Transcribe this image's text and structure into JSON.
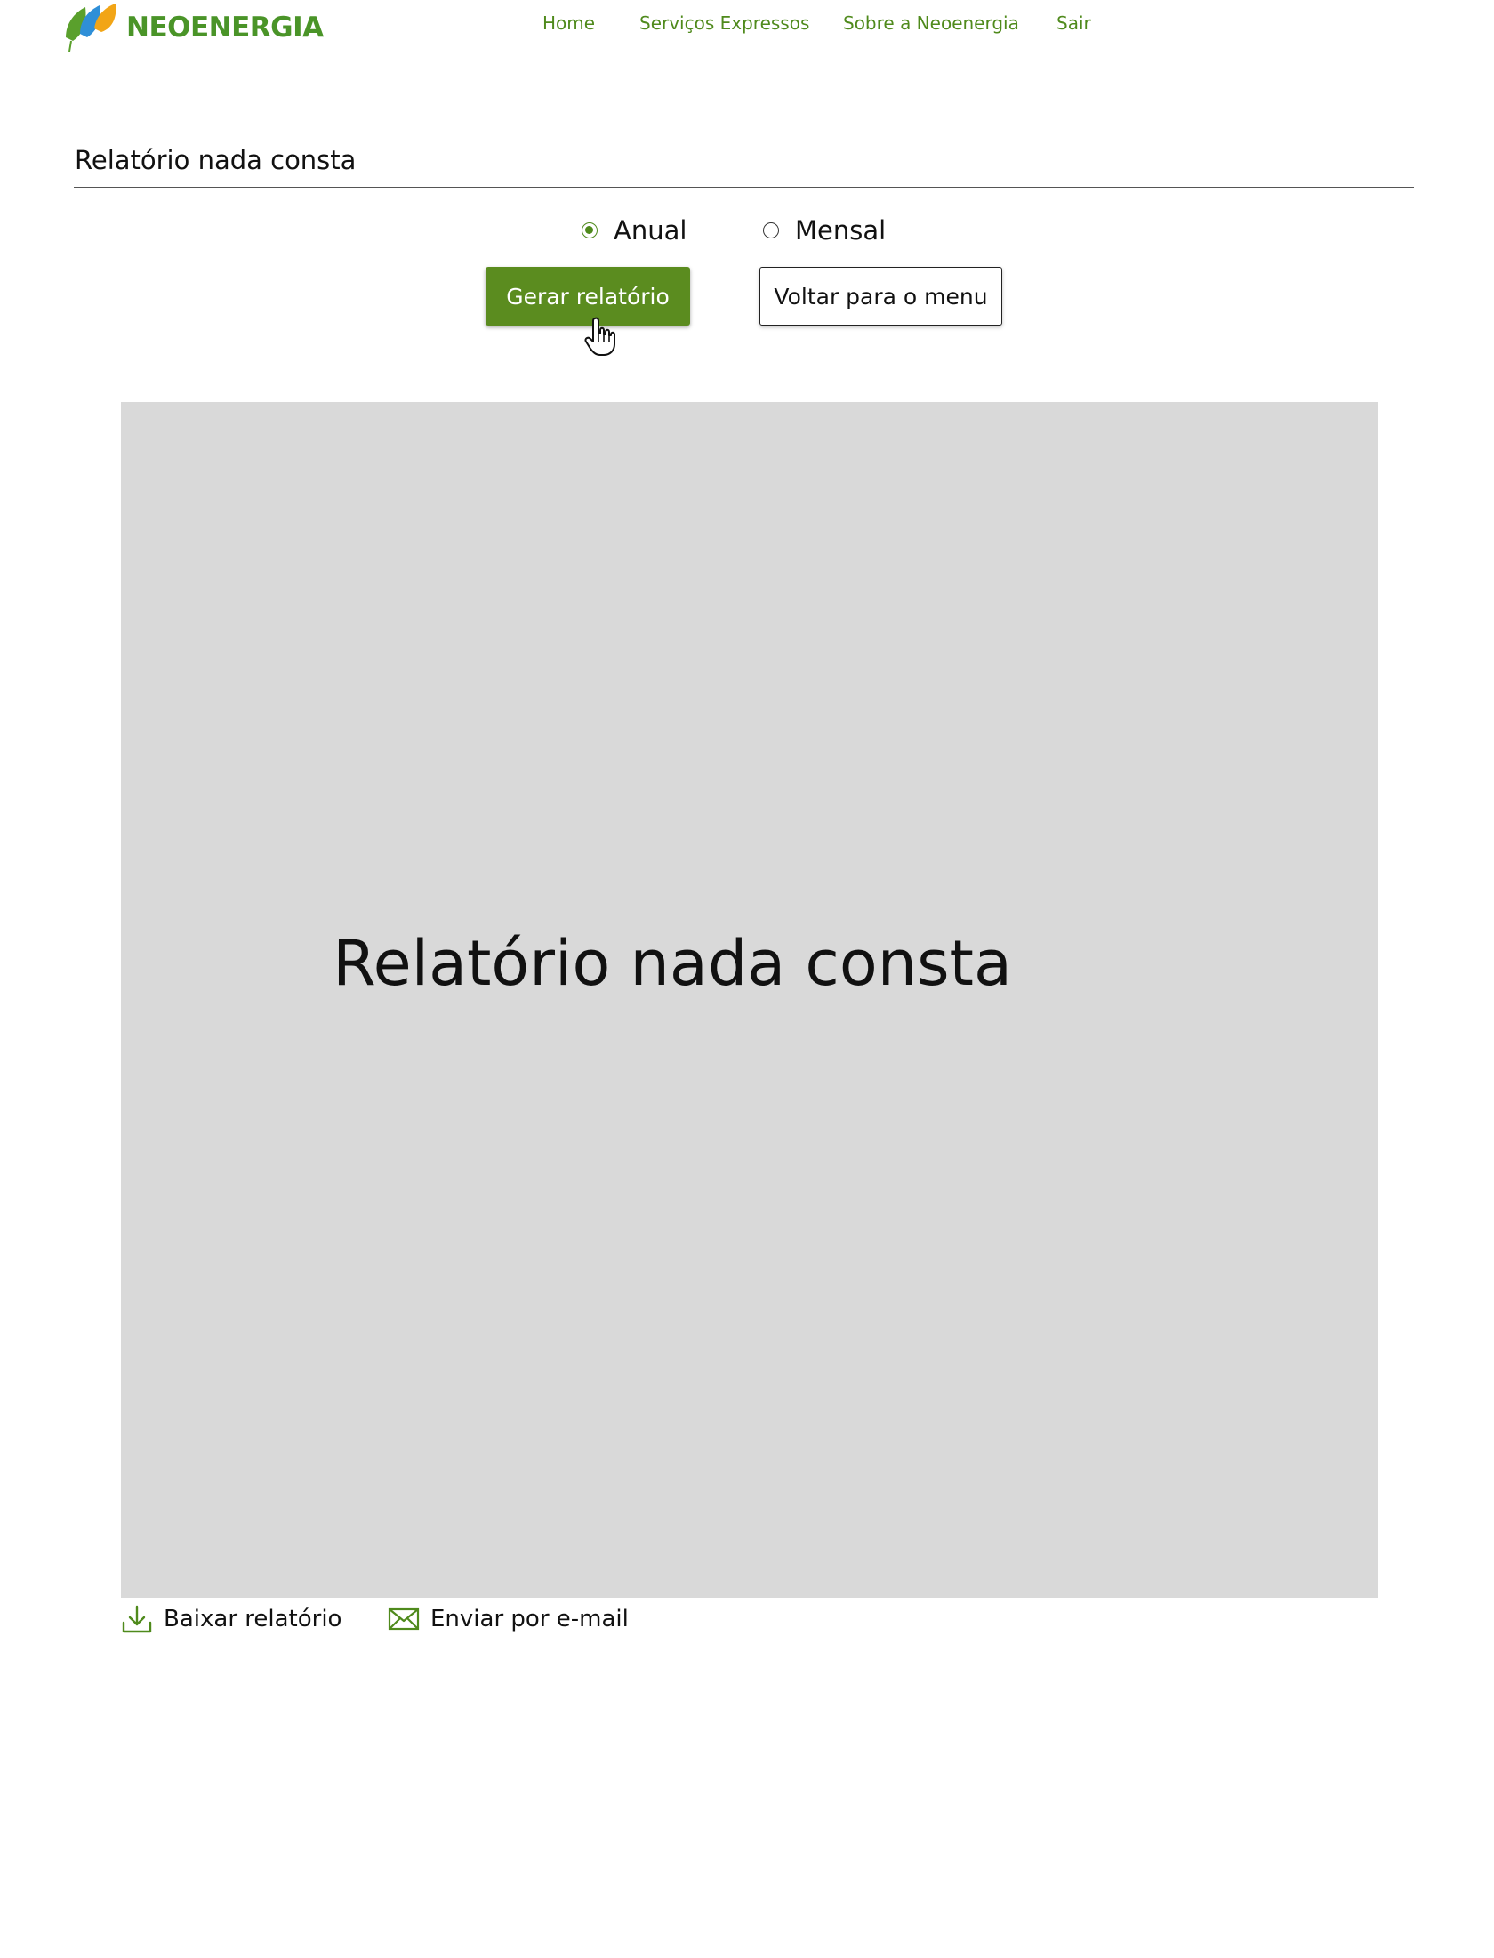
{
  "brand": {
    "name": "NEOENERGIA",
    "color": "#4a9428"
  },
  "nav": {
    "items": [
      {
        "label": "Home"
      },
      {
        "label": "Serviços Expressos"
      },
      {
        "label": "Sobre a Neoenergia"
      },
      {
        "label": "Sair"
      }
    ]
  },
  "page": {
    "title": "Relatório nada consta"
  },
  "period": {
    "options": [
      {
        "label": "Anual",
        "checked": true
      },
      {
        "label": "Mensal",
        "checked": false
      }
    ]
  },
  "buttons": {
    "generate_label": "Gerar relatório",
    "back_label": "Voltar para o menu"
  },
  "preview": {
    "title": "Relatório nada consta"
  },
  "actions": {
    "download_label": "Baixar relatório",
    "email_label": "Enviar por e-mail"
  },
  "colors": {
    "accent": "#5b8c1f",
    "preview_bg": "#d9d9d9"
  },
  "icons": {
    "download": "download-icon",
    "email": "mail-icon",
    "cursor": "hand-pointer-icon"
  }
}
